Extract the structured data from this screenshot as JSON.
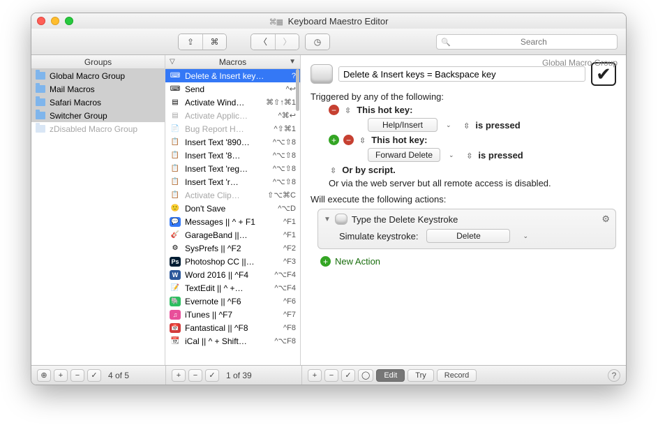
{
  "window": {
    "title": "Keyboard Maestro Editor"
  },
  "search": {
    "placeholder": "Search"
  },
  "groups": {
    "header": "Groups",
    "items": [
      {
        "label": "Global Macro Group",
        "selected": true,
        "disabled": false
      },
      {
        "label": "Mail Macros",
        "selected": true,
        "disabled": false
      },
      {
        "label": "Safari Macros",
        "selected": true,
        "disabled": false
      },
      {
        "label": "Switcher Group",
        "selected": true,
        "disabled": false
      },
      {
        "label": "zDisabled Macro Group",
        "selected": false,
        "disabled": true
      }
    ]
  },
  "macros": {
    "header": "Macros",
    "items": [
      {
        "icon": "key",
        "label": "Delete & Insert key…",
        "shortcut": "?",
        "primary": true
      },
      {
        "icon": "key",
        "label": "Send",
        "shortcut": "^↩"
      },
      {
        "icon": "window",
        "label": "Activate Wind…",
        "shortcut": "⌘⇧↑⌘1"
      },
      {
        "icon": "window",
        "label": "Activate Applic…",
        "shortcut": "^⌘↩",
        "disabled": true
      },
      {
        "icon": "doc",
        "label": "Bug Report H…",
        "shortcut": "^⇧⌘1",
        "disabled": true
      },
      {
        "icon": "clip",
        "label": "Insert Text '890…",
        "shortcut": "^⌥⇧8"
      },
      {
        "icon": "clip",
        "label": "Insert Text '8…",
        "shortcut": "^⌥⇧8"
      },
      {
        "icon": "clip",
        "label": "Insert Text 'reg…",
        "shortcut": "^⌥⇧8"
      },
      {
        "icon": "clip",
        "label": "Insert Text 'r…",
        "shortcut": "^⌥⇧8"
      },
      {
        "icon": "clip",
        "label": "Activate Clip…",
        "shortcut": "⇧⌥⌘C",
        "disabled": true
      },
      {
        "icon": "face",
        "label": "Don't Save",
        "shortcut": "^⌥D"
      },
      {
        "icon": "msgs",
        "label": "Messages || ^ + F1",
        "shortcut": "^F1"
      },
      {
        "icon": "gb",
        "label": "GarageBand ||…",
        "shortcut": "^F1"
      },
      {
        "icon": "sys",
        "label": "SysPrefs || ^F2",
        "shortcut": "^F2"
      },
      {
        "icon": "ps",
        "label": "Photoshop CC ||…",
        "shortcut": "^F3"
      },
      {
        "icon": "word",
        "label": "Word 2016 || ^F4",
        "shortcut": "^⌥F4"
      },
      {
        "icon": "te",
        "label": "TextEdit || ^ +…",
        "shortcut": "^⌥F4"
      },
      {
        "icon": "ev",
        "label": "Evernote || ^F6",
        "shortcut": "^F6"
      },
      {
        "icon": "it",
        "label": "iTunes || ^F7",
        "shortcut": "^F7"
      },
      {
        "icon": "fa",
        "label": "Fantastical || ^F8",
        "shortcut": "^F8"
      },
      {
        "icon": "ical",
        "label": "iCal || ^ + Shift…",
        "shortcut": "^⌥F8"
      }
    ]
  },
  "editor": {
    "breadcrumb": "Global Macro Group",
    "macro_name": "Delete & Insert keys = Backspace key",
    "triggered_by": "Triggered by any of the following:",
    "hotkey_label": "This hot key:",
    "ispressed": "is pressed",
    "orscript": "Or by script.",
    "remote_note": "Or via the web server but all remote access is disabled.",
    "trigger1_key": "Help/Insert",
    "trigger2_key": "Forward Delete",
    "will_execute": "Will execute the following actions:",
    "action_title": "Type the Delete Keystroke",
    "simulate_label": "Simulate keystroke:",
    "simulate_value": "Delete",
    "new_action": "New Action"
  },
  "footer": {
    "groups_count": "4 of 5",
    "macros_count": "1 of 39",
    "edit": "Edit",
    "try": "Try",
    "record": "Record"
  }
}
